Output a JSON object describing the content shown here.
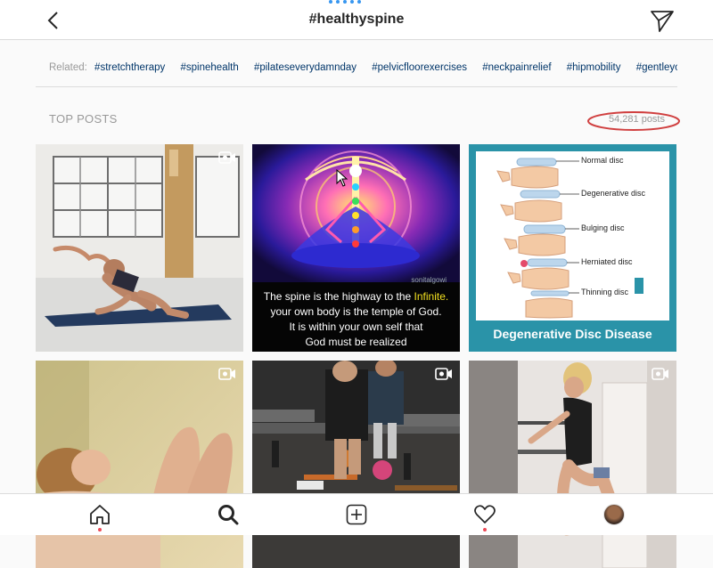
{
  "header": {
    "title": "#healthyspine",
    "back_icon": "chevron-left-icon",
    "direct_icon": "paper-plane-icon"
  },
  "related": {
    "label": "Related:",
    "tags": [
      "#stretchtherapy",
      "#spinehealth",
      "#pilateseverydamnday",
      "#pelvicfloorexercises",
      "#neckpainrelief",
      "#hipmobility",
      "#gentleyoga"
    ]
  },
  "top_posts": {
    "label": "TOP POSTS",
    "count": "54,281 posts",
    "highlight_color": "#d04040"
  },
  "posts": {
    "p2": {
      "watermark": "sonitalgowi",
      "caption_line1_a": "The spine is the highway to the ",
      "caption_line1_b": "Infinite.",
      "caption_line2": "your own body is the temple of God.",
      "caption_line3": "It is within your own self that",
      "caption_line4": "God must be realized"
    },
    "p3": {
      "title": "Degenerative Disc Disease",
      "labels": [
        "Normal disc",
        "Degenerative disc",
        "Bulging disc",
        "Herniated disc",
        "Thinning disc"
      ]
    }
  },
  "nav": {
    "items": [
      "home-icon",
      "search-icon",
      "new-post-icon",
      "activity-heart-icon",
      "profile-avatar"
    ]
  },
  "colors": {
    "accent": "#3897f0",
    "notification": "#ed4956",
    "disc_panel": "#2a93a8"
  }
}
